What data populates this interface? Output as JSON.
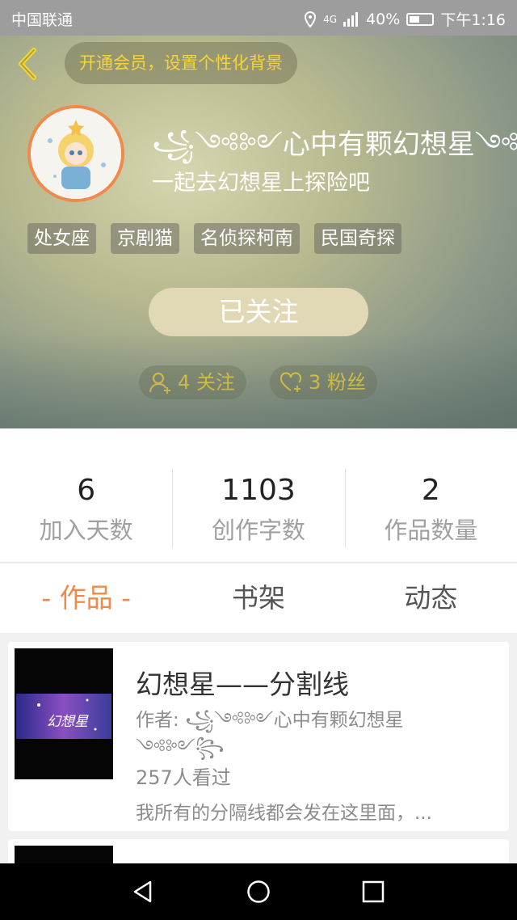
{
  "status": {
    "carrier": "中国联通",
    "network": "4G",
    "battery": "40%",
    "time": "下午1:16"
  },
  "header": {
    "vip_button": "开通会员，设置个性化背景",
    "nickname": "꧁༺༻心中有颗幻想星༺༻꧂",
    "signature": "一起去幻想星上探险吧",
    "tags": [
      "处女座",
      "京剧猫",
      "名侦探柯南",
      "民国奇探"
    ],
    "follow_button": "已关注",
    "following": "4 关注",
    "fans": "3 粉丝"
  },
  "stats": [
    {
      "value": "6",
      "label": "加入天数"
    },
    {
      "value": "1103",
      "label": "创作字数"
    },
    {
      "value": "2",
      "label": "作品数量"
    }
  ],
  "tabs": [
    "- 作品 -",
    "书架",
    "动态"
  ],
  "works": [
    {
      "title": "幻想星——分割线",
      "cover_text": "幻想星",
      "author_prefix": "作者:",
      "author": "꧁༺༻心中有颗幻想星༺༻꧂",
      "views": "257人看过",
      "description": "我所有的分隔线都会发在这里面，..."
    }
  ],
  "colors": {
    "accent": "#f08a4a",
    "gold": "#f5d53a"
  }
}
